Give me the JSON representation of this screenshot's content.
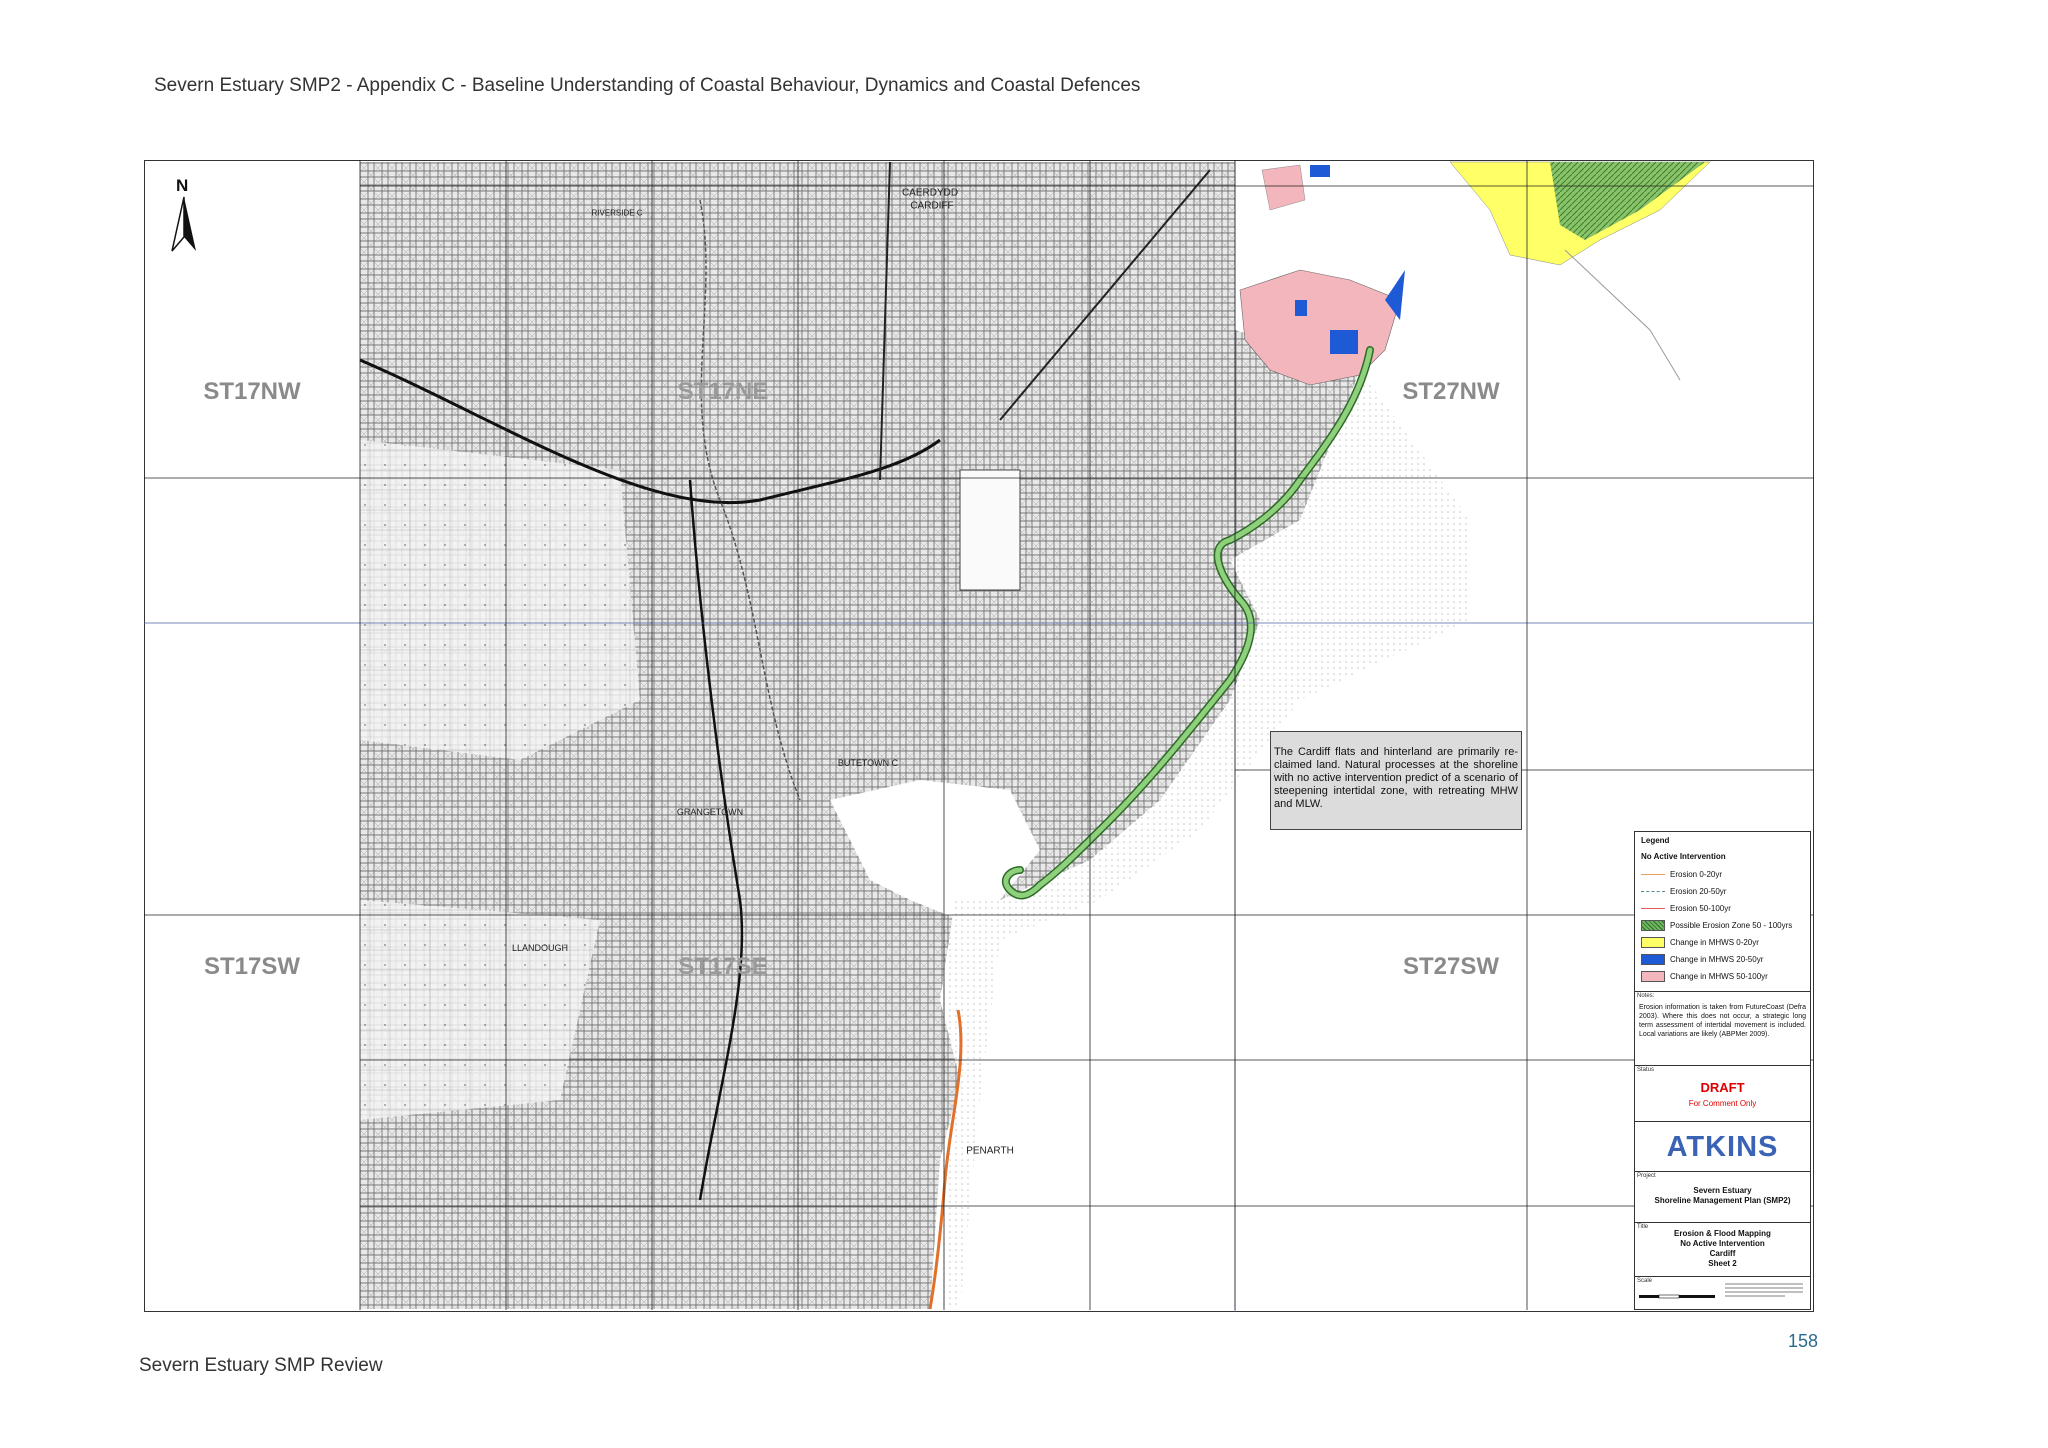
{
  "header": {
    "title": "Severn Estuary SMP2 - Appendix C - Baseline Understanding of Coastal Behaviour, Dynamics and Coastal Defences"
  },
  "footer": {
    "title": "Severn Estuary SMP Review",
    "page_number": "158"
  },
  "map": {
    "north_label": "N",
    "grid_labels": [
      "ST17NW",
      "ST17NE",
      "ST27NW",
      "ST17SW",
      "ST17SE",
      "ST27SW"
    ],
    "place_labels": [
      "CAERDYDD",
      "CARDIFF",
      "RIVERSIDE C",
      "BUTETOWN C",
      "GRANGETOWN",
      "LLANDOUGH",
      "PENARTH"
    ],
    "annotation": "The Cardiff flats and hinterland are primarily re-claimed land. Natural processes at the shoreline with no active intervention predict of a scenario of steepening intertidal zone, with retreating MHW and MLW."
  },
  "title_block": {
    "legend_title": "Legend",
    "legend_subtitle": "No Active Intervention",
    "legend_items": [
      {
        "label": "Erosion 0-20yr",
        "kind": "line",
        "color": "#e8a05a",
        "dash": "solid"
      },
      {
        "label": "Erosion 20-50yr",
        "kind": "line",
        "color": "#5a8a9a",
        "dash": "dashed"
      },
      {
        "label": "Erosion 50-100yr",
        "kind": "line",
        "color": "#e06060",
        "dash": "solid"
      },
      {
        "label": "Possible Erosion Zone 50 - 100yrs",
        "kind": "fill",
        "color": "#6fb560"
      },
      {
        "label": "Change in MHWS 0-20yr",
        "kind": "fill",
        "color": "#ffff66"
      },
      {
        "label": "Change in MHWS 20-50yr",
        "kind": "fill",
        "color": "#1f5ad6"
      },
      {
        "label": "Change in MHWS 50-100yr",
        "kind": "fill",
        "color": "#f4b6bd"
      }
    ],
    "notes_label": "Notes:",
    "notes_text": "Erosion information is taken from FutureCoast (Defra 2003). Where this does not occur, a strategic long term assessment of intertidal movement is included. Local variations are likely (ABPMer 2009).",
    "status_label": "Status",
    "status": "DRAFT",
    "status_sub": "For Comment Only",
    "logo": "ATKINS",
    "project_label": "Project",
    "project_line1": "Severn Estuary",
    "project_line2": "Shoreline Management Plan (SMP2)",
    "title_label": "Title",
    "title_line1": "Erosion & Flood Mapping",
    "title_line2": "No Active Intervention",
    "title_line3": "Cardiff",
    "title_line4": "Sheet 2",
    "scale_label": "Scale"
  },
  "colors": {
    "erosion_zone": "#6fb560",
    "mhws_0_20": "#ffff66",
    "mhws_20_50": "#1f5ad6",
    "mhws_50_100": "#f4b6bd",
    "erosion_0_20_line": "#e0702a",
    "draft_red": "#e00000",
    "atkins_blue": "#3b63b5"
  }
}
